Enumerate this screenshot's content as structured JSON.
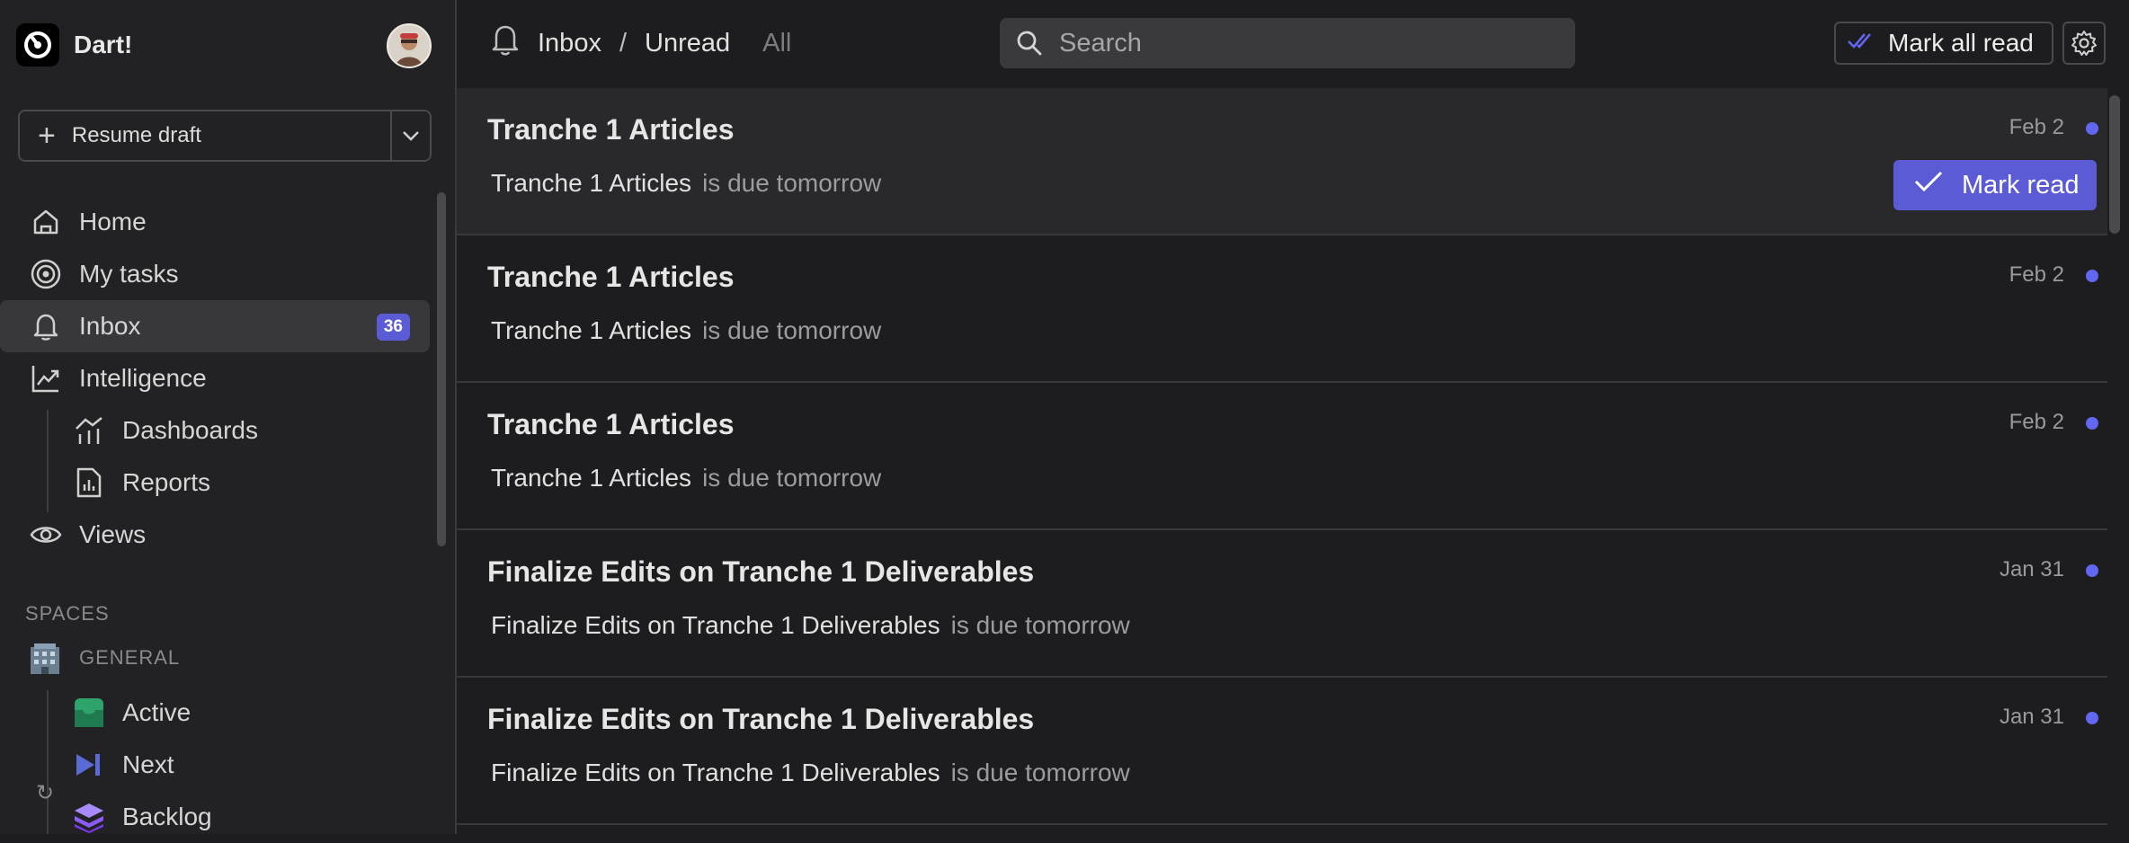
{
  "workspace": {
    "name": "Dart!"
  },
  "sidebar": {
    "resume_label": "Resume draft",
    "items": [
      {
        "label": "Home",
        "icon": "home-icon"
      },
      {
        "label": "My tasks",
        "icon": "target-icon"
      },
      {
        "label": "Inbox",
        "icon": "bell-icon",
        "badge": "36",
        "active": true
      },
      {
        "label": "Intelligence",
        "icon": "trend-chart-icon"
      },
      {
        "label": "Dashboards",
        "icon": "dashboards-icon",
        "child": true
      },
      {
        "label": "Reports",
        "icon": "report-icon",
        "child": true
      },
      {
        "label": "Views",
        "icon": "eye-icon"
      }
    ],
    "spaces_heading": "SPACES",
    "space": {
      "name": "GENERAL",
      "icon": "building-icon"
    },
    "dartboards": [
      {
        "label": "Active",
        "icon": "inbox-tray-icon",
        "color": "#2ea36b"
      },
      {
        "label": "Next",
        "icon": "next-arrow-icon",
        "color": "#5b6bd6"
      },
      {
        "label": "Backlog",
        "icon": "layers-icon",
        "color": "#8b5cf6"
      }
    ]
  },
  "header": {
    "crumb_root": "Inbox",
    "crumb_sep": "/",
    "crumb_current": "Unread",
    "crumb_alt": "All",
    "search_placeholder": "Search",
    "mark_all_label": "Mark all read"
  },
  "notifications": [
    {
      "title": "Tranche 1 Articles",
      "task": "Tranche 1 Articles",
      "suffix": "is due tomorrow",
      "date": "Feb 2",
      "hover": true
    },
    {
      "title": "Tranche 1 Articles",
      "task": "Tranche 1 Articles",
      "suffix": "is due tomorrow",
      "date": "Feb 2"
    },
    {
      "title": "Tranche 1 Articles",
      "task": "Tranche 1 Articles",
      "suffix": "is due tomorrow",
      "date": "Feb 2"
    },
    {
      "title": "Finalize Edits on Tranche 1 Deliverables",
      "task": "Finalize Edits on Tranche 1 Deliverables",
      "suffix": "is due tomorrow",
      "date": "Jan 31"
    },
    {
      "title": "Finalize Edits on Tranche 1 Deliverables",
      "task": "Finalize Edits on Tranche 1 Deliverables",
      "suffix": "is due tomorrow",
      "date": "Jan 31"
    }
  ],
  "mark_read_label": "Mark read",
  "colors": {
    "accent": "#5b5bd6",
    "unread_dot": "#6366f1",
    "background": "#1d1d1f"
  }
}
